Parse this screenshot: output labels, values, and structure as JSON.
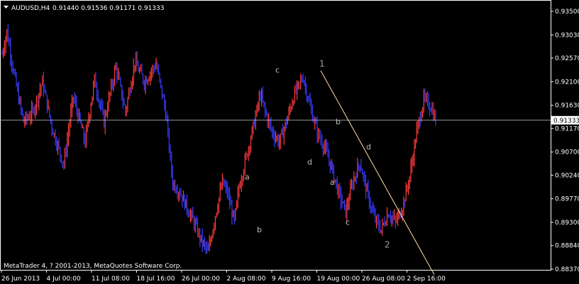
{
  "header": {
    "symbol_timeframe": "AUDUSD,H4",
    "ohlc": "0.91440 0.91536 0.91171 0.91333"
  },
  "footer": {
    "copyright": "MetaTrader 4, ? 2001-2013, MetaQuotes Software Corp."
  },
  "colors": {
    "background": "#000000",
    "bull_candle": "#ff3b3b",
    "bear_candle": "#3a3aff",
    "axis": "#ffffff",
    "bid_line": "#c8c8c8",
    "trendline": "#ffe0a0",
    "wave_label": "#bdbdbd"
  },
  "chart_data": {
    "type": "candlestick",
    "ylim": [
      0.8837,
      0.935
    ],
    "y_ticks": [
      "0.93500",
      "0.93030",
      "0.92570",
      "0.92100",
      "0.91630",
      "0.91170",
      "0.90700",
      "0.90240",
      "0.89770",
      "0.89300",
      "0.88840",
      "0.88370"
    ],
    "x_ticks": [
      "26 Jun 2013",
      "4 Jul 00:00",
      "11 Jul 08:00",
      "18 Jul 16:00",
      "26 Jul 00:00",
      "2 Aug 08:00",
      "9 Aug 16:00",
      "19 Aug 00:00",
      "26 Aug 08:00",
      "2 Sep 16:00"
    ],
    "current_price": "0.91333",
    "anchors": [
      [
        0,
        0.9265
      ],
      [
        4,
        0.931
      ],
      [
        10,
        0.9225
      ],
      [
        18,
        0.913
      ],
      [
        26,
        0.915
      ],
      [
        34,
        0.921
      ],
      [
        42,
        0.912
      ],
      [
        52,
        0.9045
      ],
      [
        60,
        0.918
      ],
      [
        70,
        0.909
      ],
      [
        78,
        0.9215
      ],
      [
        86,
        0.913
      ],
      [
        96,
        0.924
      ],
      [
        104,
        0.915
      ],
      [
        112,
        0.925
      ],
      [
        120,
        0.921
      ],
      [
        130,
        0.9245
      ],
      [
        138,
        0.915
      ],
      [
        144,
        0.901
      ],
      [
        150,
        0.899
      ],
      [
        156,
        0.896
      ],
      [
        162,
        0.893
      ],
      [
        168,
        0.8895
      ],
      [
        174,
        0.887
      ],
      [
        180,
        0.8945
      ],
      [
        186,
        0.901
      ],
      [
        190,
        0.899
      ],
      [
        196,
        0.893
      ],
      [
        200,
        0.9
      ],
      [
        206,
        0.906
      ],
      [
        212,
        0.912
      ],
      [
        218,
        0.9185
      ],
      [
        222,
        0.915
      ],
      [
        228,
        0.911
      ],
      [
        234,
        0.909
      ],
      [
        240,
        0.913
      ],
      [
        246,
        0.918
      ],
      [
        254,
        0.922
      ],
      [
        260,
        0.916
      ],
      [
        266,
        0.911
      ],
      [
        272,
        0.908
      ],
      [
        278,
        0.904
      ],
      [
        284,
        0.899
      ],
      [
        290,
        0.895
      ],
      [
        296,
        0.901
      ],
      [
        302,
        0.905
      ],
      [
        308,
        0.899
      ],
      [
        314,
        0.894
      ],
      [
        320,
        0.8915
      ],
      [
        326,
        0.895
      ],
      [
        332,
        0.893
      ],
      [
        338,
        0.896
      ],
      [
        344,
        0.902
      ],
      [
        350,
        0.911
      ],
      [
        356,
        0.9175
      ],
      [
        362,
        0.916
      ],
      [
        366,
        0.9133
      ]
    ],
    "annotations": [
      {
        "label": "c",
        "x": "9 Aug 16:00",
        "y": 0.9228
      },
      {
        "label": "1",
        "x": "19 Aug 00:00",
        "y": 0.924
      },
      {
        "label": "a",
        "x": "2 Aug 08:00",
        "y": 0.9015
      },
      {
        "label": "b",
        "x": "2 Aug 08:00",
        "y": 0.891
      },
      {
        "label": "d",
        "x": "9 Aug 16:00",
        "y": 0.9045
      },
      {
        "label": "b",
        "x": "19 Aug 00:00",
        "y": 0.9125
      },
      {
        "label": "a",
        "x": "19 Aug 00:00",
        "y": 0.9005
      },
      {
        "label": "d",
        "x": "26 Aug 08:00",
        "y": 0.9075
      },
      {
        "label": "c",
        "x": "19 Aug 00:00",
        "y": 0.8925
      },
      {
        "label": "2",
        "x": "26 Aug 08:00",
        "y": 0.888
      }
    ]
  }
}
